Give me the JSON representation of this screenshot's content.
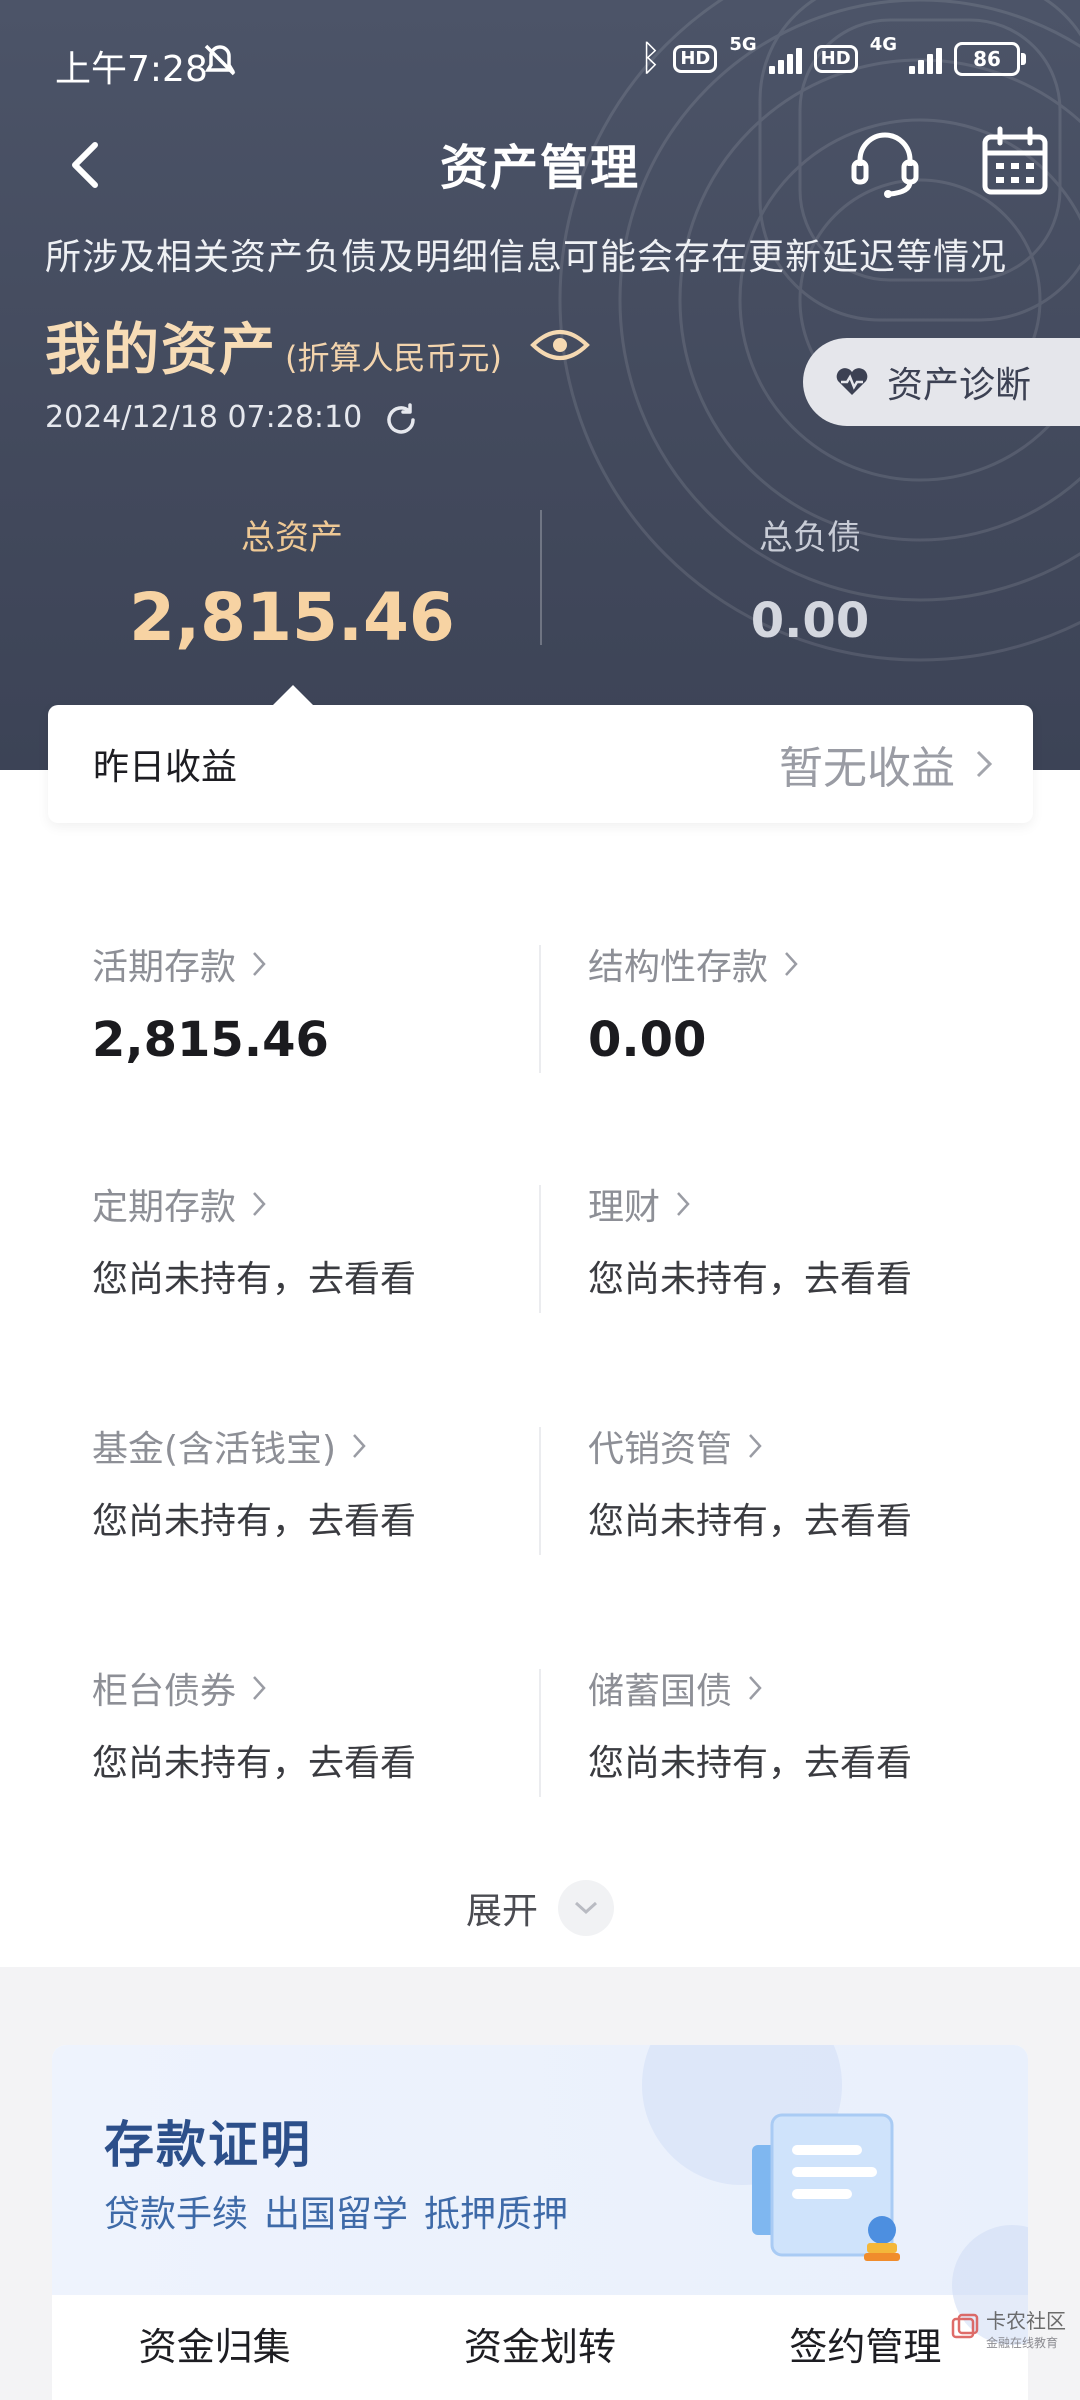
{
  "status_bar": {
    "time": "上午7:28",
    "network_1": "5G",
    "network_2": "4G",
    "hd_badge": "HD",
    "battery": "86"
  },
  "nav": {
    "title": "资产管理",
    "back_icon": "chevron-left-icon",
    "service_icon": "headset-icon",
    "calendar_icon": "calendar-icon"
  },
  "notice": "所涉及相关资产负债及明细信息可能会存在更新延迟等情况",
  "my_assets": {
    "title": "我的资产",
    "subtitle": "(折算人民币元)",
    "timestamp": "2024/12/18 07:28:10",
    "diagnosis_button": "资产诊断"
  },
  "totals": {
    "assets_label": "总资产",
    "assets_value": "2,815.46",
    "liabilities_label": "总负债",
    "liabilities_value": "0.00"
  },
  "income": {
    "label": "昨日收益",
    "value": "暂无收益"
  },
  "asset_items": [
    {
      "name": "活期存款",
      "value": "2,815.46"
    },
    {
      "name": "结构性存款",
      "value": "0.00"
    },
    {
      "name": "定期存款",
      "value": "您尚未持有，去看看"
    },
    {
      "name": "理财",
      "value": "您尚未持有，去看看"
    },
    {
      "name": "基金(含活钱宝)",
      "value": "您尚未持有，去看看"
    },
    {
      "name": "代销资管",
      "value": "您尚未持有，去看看"
    },
    {
      "name": "柜台债券",
      "value": "您尚未持有，去看看"
    },
    {
      "name": "储蓄国债",
      "value": "您尚未持有，去看看"
    }
  ],
  "expand_label": "展开",
  "certificate": {
    "title": "存款证明",
    "tags": [
      "贷款手续",
      "出国留学",
      "抵押质押"
    ],
    "actions": [
      "资金归集",
      "资金划转",
      "签约管理"
    ]
  },
  "watermark": {
    "name": "卡农社区",
    "tagline": "金融在线教育"
  },
  "colors": {
    "header_bg": "#474e62",
    "gold_text": "#f7d3a3",
    "cert_blue": "#2c4f8a"
  }
}
